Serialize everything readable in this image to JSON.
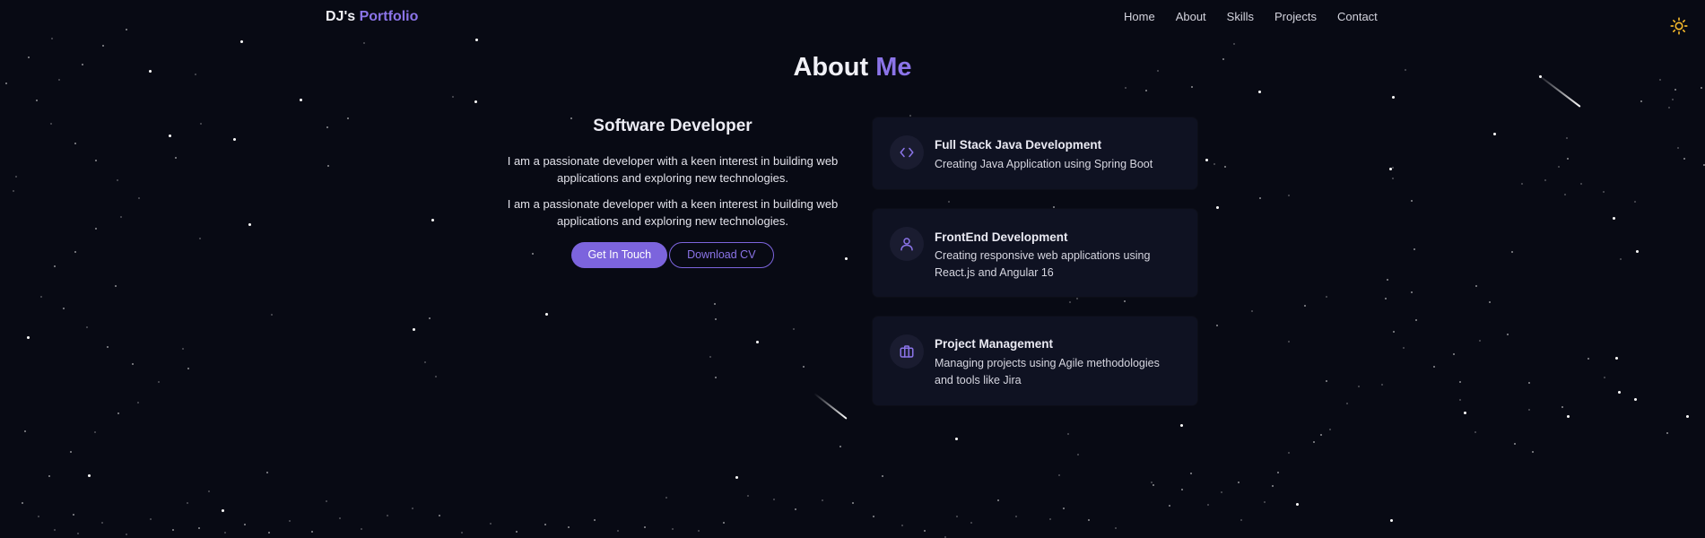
{
  "brand": {
    "prefix": "DJ's",
    "accent": "Portfolio"
  },
  "nav": {
    "items": [
      {
        "label": "Home"
      },
      {
        "label": "About"
      },
      {
        "label": "Skills"
      },
      {
        "label": "Projects"
      },
      {
        "label": "Contact"
      }
    ],
    "theme_toggle_icon": "sun-icon"
  },
  "section": {
    "title_main": "About",
    "title_accent": "Me"
  },
  "about": {
    "role": "Software Developer",
    "paragraphs": [
      "I am a passionate developer with a keen interest in building web applications and exploring new technologies.",
      "I am a passionate developer with a keen interest in building web applications and exploring new technologies."
    ],
    "primary_button": "Get In Touch",
    "secondary_button": "Download CV"
  },
  "services": [
    {
      "icon": "code-icon",
      "title": "Full Stack Java Development",
      "description": "Creating Java Application using Spring Boot"
    },
    {
      "icon": "user-icon",
      "title": "FrontEnd Development",
      "description": "Creating responsive web applications using React.js and Angular 16"
    },
    {
      "icon": "briefcase-icon",
      "title": "Project Management",
      "description": "Managing projects using Agile methodologies and tools like Jira"
    }
  ],
  "colors": {
    "background": "#080a14",
    "accent": "#8b74e8",
    "button": "#7c64dd",
    "card": "#0f1222",
    "sun": "#f0b429"
  }
}
